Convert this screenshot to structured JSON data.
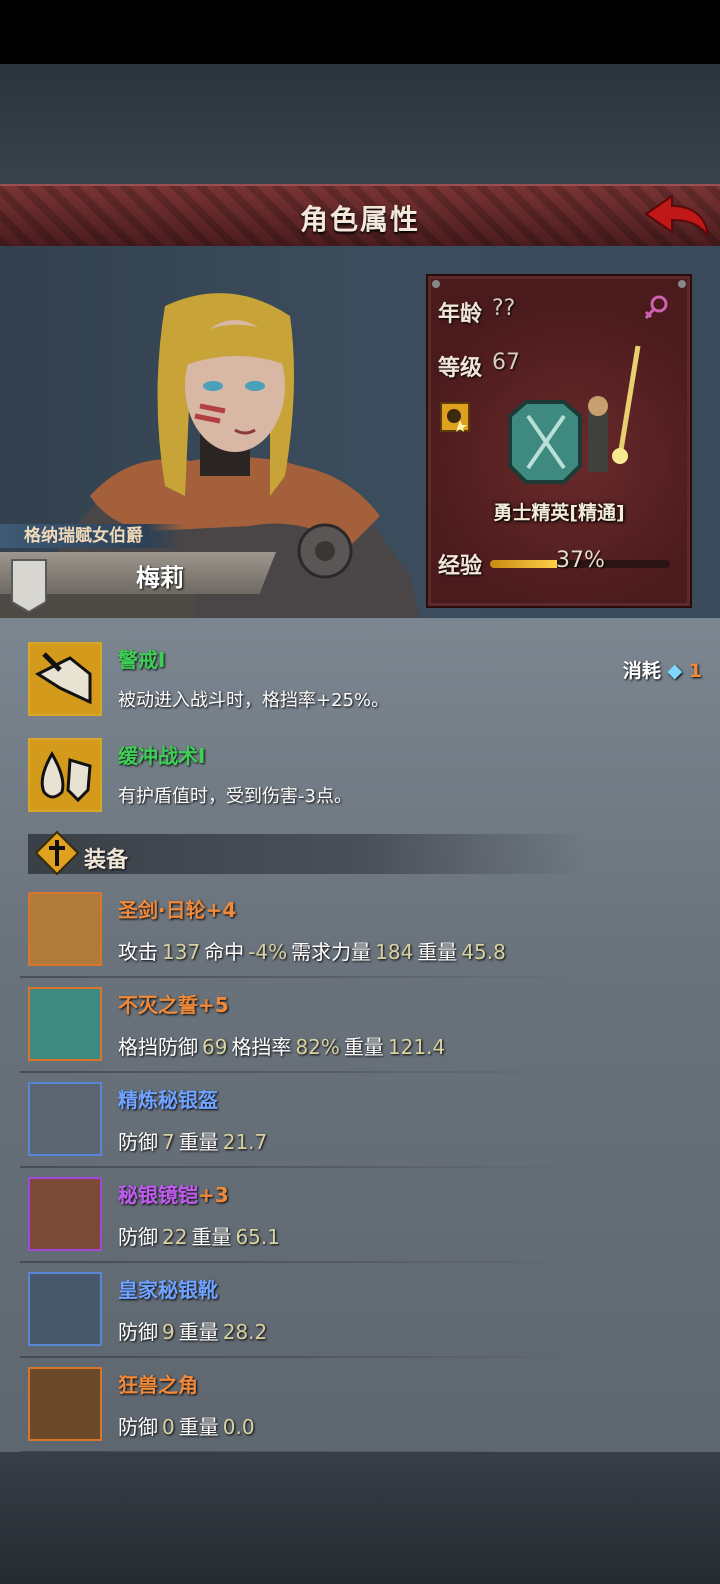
{
  "header": {
    "title": "角色属性"
  },
  "character": {
    "title_tag": "格纳瑞赋女伯爵",
    "name": "梅莉",
    "age_label": "年龄",
    "age_value": "??",
    "level_label": "等级",
    "level_value": "67",
    "class_name": "勇士精英[精通]",
    "exp_label": "经验",
    "exp_percent": "37%",
    "exp_fraction": 0.37
  },
  "skills": [
    {
      "name": "警戒Ⅰ",
      "desc": "被动进入战斗时，格挡率+25%。"
    },
    {
      "name": "缓冲战术Ⅰ",
      "desc": "有护盾值时，受到伤害-3点。"
    }
  ],
  "cost": {
    "label": "消耗",
    "value": "1"
  },
  "equipment_section": {
    "title": "装备"
  },
  "equipment": [
    {
      "name": "圣剑·日轮",
      "plus": "+4",
      "color": "#f08a3a",
      "border": "#d9742c",
      "stats": [
        [
          "攻击",
          "137"
        ],
        [
          "命中",
          "-4%"
        ],
        [
          "需求力量",
          "184"
        ],
        [
          "重量",
          "45.8"
        ]
      ]
    },
    {
      "name": "不灭之誓",
      "plus": "+5",
      "color": "#f08a3a",
      "border": "#d9742c",
      "stats": [
        [
          "格挡防御",
          "69"
        ],
        [
          "格挡率",
          "82%"
        ],
        [
          "重量",
          "121.4"
        ]
      ]
    },
    {
      "name": "精炼秘银盔",
      "plus": "",
      "color": "#6fa3ff",
      "border": "#5a86d8",
      "stats": [
        [
          "防御",
          "7"
        ],
        [
          "重量",
          "21.7"
        ]
      ]
    },
    {
      "name": "秘银镜铠",
      "plus": "+3",
      "color": "#c05cf0",
      "border": "#a347d6",
      "stats": [
        [
          "防御",
          "22"
        ],
        [
          "重量",
          "65.1"
        ]
      ]
    },
    {
      "name": "皇家秘银靴",
      "plus": "",
      "color": "#6fa3ff",
      "border": "#5a86d8",
      "stats": [
        [
          "防御",
          "9"
        ],
        [
          "重量",
          "28.2"
        ]
      ]
    },
    {
      "name": "狂兽之角",
      "plus": "",
      "color": "#f08a3a",
      "border": "#d9742c",
      "stats": [
        [
          "防御",
          "0"
        ],
        [
          "重量",
          "0.0"
        ]
      ]
    }
  ]
}
